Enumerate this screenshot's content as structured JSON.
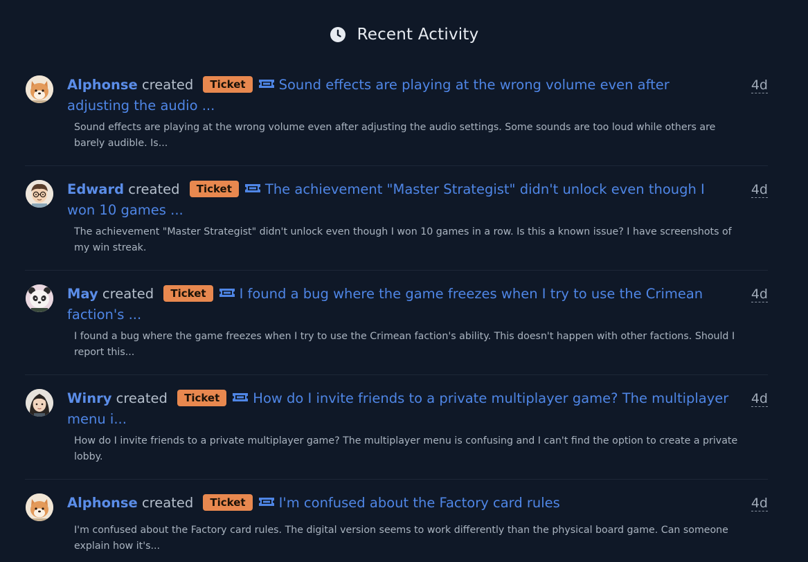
{
  "header": {
    "title": "Recent Activity",
    "icon": "clock-icon"
  },
  "colors": {
    "background": "#0f1827",
    "username": "#5b8de8",
    "link": "#4f86e6",
    "badge": "#e8884f"
  },
  "activities": [
    {
      "user": "Alphonse",
      "verb": "created",
      "badge": "Ticket",
      "icon": "ticket-icon",
      "title": "Sound effects are playing at the wrong volume even after adjusting the audio ...",
      "time": "4d",
      "description": "Sound effects are playing at the wrong volume even after adjusting the audio settings. Some sounds are too loud while others are barely audible. Is...",
      "avatar": "shiba-avatar"
    },
    {
      "user": "Edward",
      "verb": "created",
      "badge": "Ticket",
      "icon": "ticket-icon",
      "title": "The achievement \"Master Strategist\" didn't unlock even though I won 10 games ...",
      "time": "4d",
      "description": "The achievement \"Master Strategist\" didn't unlock even though I won 10 games in a row. Is this a known issue? I have screenshots of my win streak.",
      "avatar": "glasses-avatar"
    },
    {
      "user": "May",
      "verb": "created",
      "badge": "Ticket",
      "icon": "ticket-icon",
      "title": "I found a bug where the game freezes when I try to use the Crimean faction's ...",
      "time": "4d",
      "description": "I found a bug where the game freezes when I try to use the Crimean faction's ability. This doesn't happen with other factions. Should I report this...",
      "avatar": "panda-avatar"
    },
    {
      "user": "Winry",
      "verb": "created",
      "badge": "Ticket",
      "icon": "ticket-icon",
      "title": "How do I invite friends to a private multiplayer game? The multiplayer menu i...",
      "time": "4d",
      "description": "How do I invite friends to a private multiplayer game? The multiplayer menu is confusing and I can't find the option to create a private lobby.",
      "avatar": "girl-avatar"
    },
    {
      "user": "Alphonse",
      "verb": "created",
      "badge": "Ticket",
      "icon": "ticket-icon",
      "title": "I'm confused about the Factory card rules",
      "time": "4d",
      "description": "I'm confused about the Factory card rules. The digital version seems to work differently than the physical board game. Can someone explain how it's...",
      "avatar": "shiba-avatar"
    }
  ]
}
